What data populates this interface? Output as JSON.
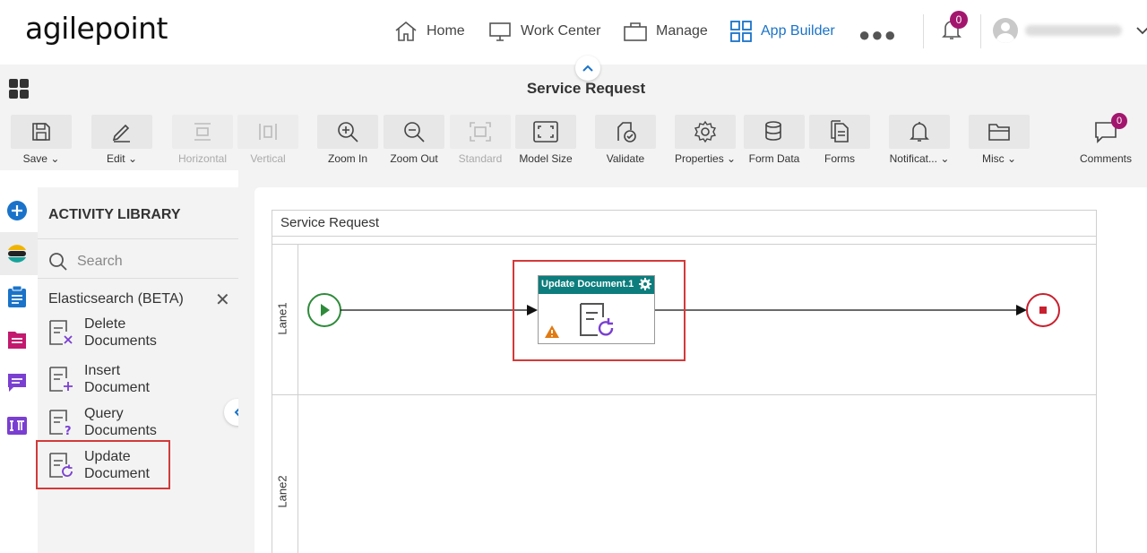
{
  "brand": {
    "logo_text": "agilepoint"
  },
  "nav": {
    "home": "Home",
    "work_center": "Work Center",
    "manage": "Manage",
    "app_builder": "App Builder",
    "active_color": "#1a73c9"
  },
  "notifications": {
    "count": "0"
  },
  "page": {
    "title": "Service Request"
  },
  "toolbar": {
    "save": "Save",
    "edit": "Edit",
    "horizontal": "Horizontal",
    "vertical": "Vertical",
    "zoom_in": "Zoom In",
    "zoom_out": "Zoom Out",
    "standard": "Standard",
    "model_size": "Model Size",
    "validate": "Validate",
    "properties": "Properties",
    "form_data": "Form Data",
    "forms": "Forms",
    "notifications": "Notificat...",
    "misc": "Misc",
    "comments": "Comments",
    "comments_count": "0"
  },
  "library": {
    "title": "ACTIVITY LIBRARY",
    "search_placeholder": "Search",
    "category": "Elasticsearch (BETA)",
    "items": [
      {
        "label": "Delete Documents",
        "icon": "delete-document-icon"
      },
      {
        "label": "Insert Document",
        "icon": "insert-document-icon"
      },
      {
        "label": "Query Documents",
        "icon": "query-document-icon"
      },
      {
        "label": "Update Document",
        "icon": "update-document-icon"
      }
    ]
  },
  "process": {
    "pool_title": "Service Request",
    "lanes": [
      "Lane1",
      "Lane2"
    ],
    "activity": {
      "title": "Update Document.1",
      "header_color": "#0d7d7d",
      "has_warning": true
    }
  }
}
